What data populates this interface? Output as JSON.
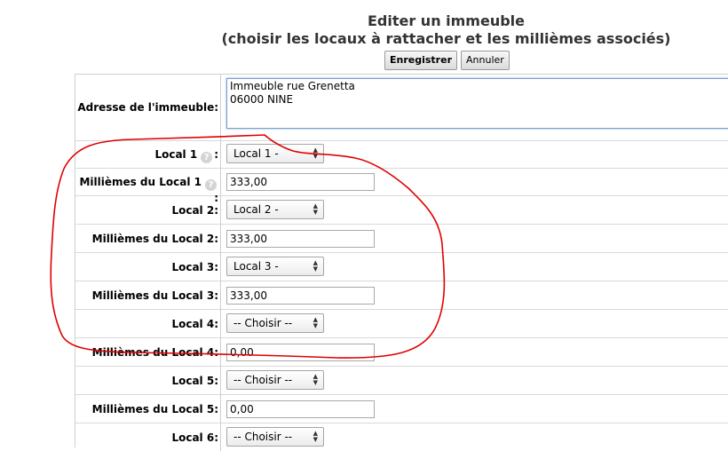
{
  "page": {
    "title_line1": "Editer un immeuble",
    "title_line2": "(choisir les locaux à rattacher et les millièmes associés)",
    "save_label": "Enregistrer",
    "cancel_label": "Annuler"
  },
  "form": {
    "address": {
      "label": "Adresse de l'immeuble:",
      "value": "Immeuble rue Grenetta\n06000 NINE"
    },
    "rows": [
      {
        "label": "Local 1",
        "suffix": ":",
        "value": "Local 1 -",
        "help": "?"
      },
      {
        "label": "Millièmes du Local 1",
        "suffix": ":",
        "value": "333,00",
        "help": "?"
      },
      {
        "label": "Local 2:",
        "value": "Local 2 -"
      },
      {
        "label": "Millièmes du Local 2:",
        "value": "333,00"
      },
      {
        "label": "Local 3:",
        "value": "Local 3 -"
      },
      {
        "label": "Millièmes du Local 3:",
        "value": "333,00"
      },
      {
        "label": "Local 4:",
        "value": "-- Choisir --"
      },
      {
        "label": "Millièmes du Local 4:",
        "value": "0,00"
      },
      {
        "label": "Local 5:",
        "value": "-- Choisir --"
      },
      {
        "label": "Millièmes du Local 5:",
        "value": "0,00"
      },
      {
        "label": "Local 6:",
        "value": "-- Choisir --"
      }
    ]
  },
  "annotation": {
    "color": "#e00000"
  }
}
